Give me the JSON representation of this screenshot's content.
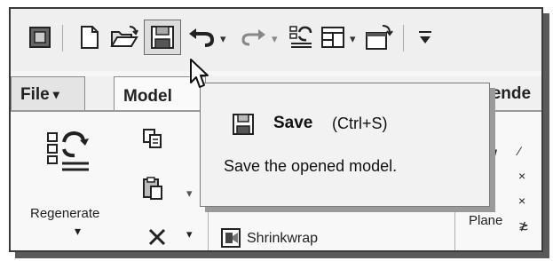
{
  "toolbar": {
    "icons": [
      "window-icon",
      "new-file-icon",
      "open-folder-icon",
      "save-icon",
      "undo-icon",
      "redo-icon",
      "regenerate-icon",
      "windows-icon",
      "close-window-icon",
      "customize-icon"
    ],
    "hovered": "save-icon"
  },
  "tabs": [
    {
      "label": "File",
      "arrow": "▾"
    },
    {
      "label": "Model"
    },
    {
      "label": "Rende"
    }
  ],
  "ribbon": {
    "regenerate_label": "Regenerate",
    "regenerate_arrow": "▾",
    "shrinkwrap_label": "Shrinkwrap",
    "plane_label": "Plane"
  },
  "tooltip": {
    "title": "Save",
    "shortcut": "(Ctrl+S)",
    "description": "Save the opened model."
  },
  "colors": {
    "background": "#f6f6f6",
    "border": "#3a3a3a",
    "tooltip_bg": "#f2f2f2",
    "shadow": "#5a5a5a"
  }
}
